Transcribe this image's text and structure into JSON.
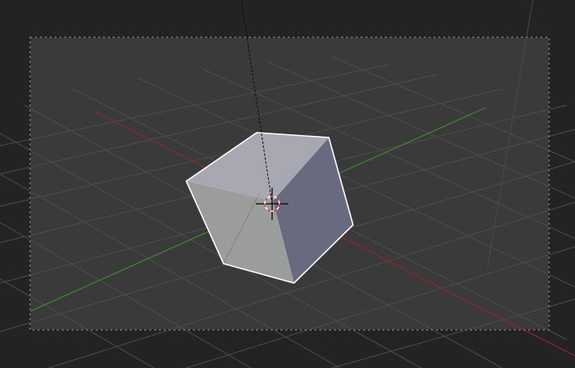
{
  "viewport": {
    "mode": "camera-view",
    "selected_object": "cube",
    "colors": {
      "outer_background": "#232323",
      "camera_frame_background": "#3a3a3a",
      "camera_frame_border": "#0c0c0c",
      "grid_line": "#4d4d4d",
      "x_axis": "#8b2a2a",
      "y_axis": "#3f8a2e",
      "selection_outline": "#ffffff",
      "cube_top_face": "#a7a8b1",
      "cube_front_face": "#9b9c9c",
      "cube_right_face": "#686a80",
      "cursor_red": "#d23a3a",
      "cursor_white": "#ffffff"
    },
    "icons": {
      "cursor": "3d-cursor-icon",
      "camera_frame": "camera-frame-icon"
    }
  }
}
